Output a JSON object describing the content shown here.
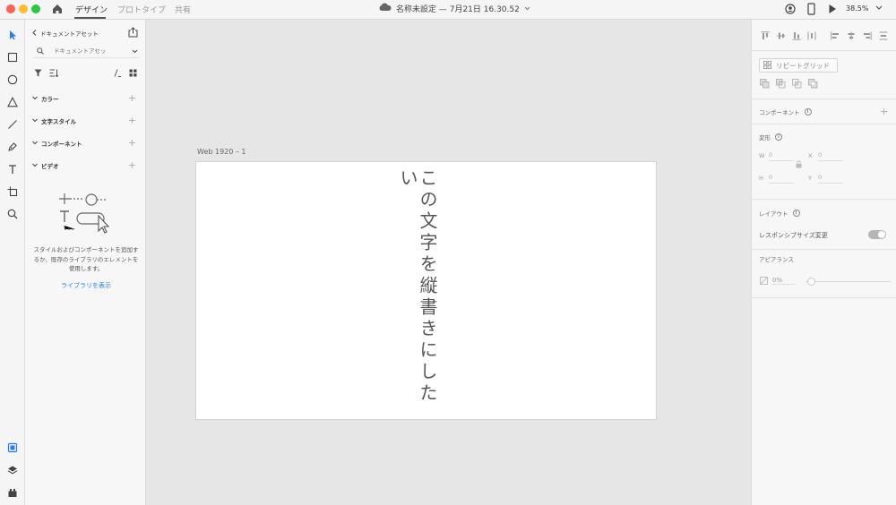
{
  "titlebar": {
    "tabs": [
      "デザイン",
      "プロトタイプ",
      "共有"
    ],
    "active_tab": "デザイン",
    "doc_title": "名称未設定 — 7月21日 16.30.52",
    "zoom": "38.5%"
  },
  "toolbar": {
    "tools": [
      "select-icon",
      "rectangle-icon",
      "ellipse-icon",
      "polygon-icon",
      "line-icon",
      "pen-icon",
      "text-icon",
      "artboard-icon",
      "zoom-icon"
    ],
    "bottom": [
      "assets-icon",
      "layers-icon",
      "plugins-icon"
    ]
  },
  "assets": {
    "back_label": "ドキュメントアセット",
    "search_placeholder": "ドキュメントアセッ",
    "sections": [
      "カラー",
      "文字スタイル",
      "コンポーネント",
      "ビデオ"
    ],
    "help_text": "スタイルおよびコンポーネントを追加するか、既存のライブラリのエレメントを使用します。",
    "library_link": "ライブラリを表示"
  },
  "canvas": {
    "artboard_label": "Web 1920 – 1",
    "vertical_text": "この文字を縦書きにしたい"
  },
  "props": {
    "repeat_grid": "リピートグリッド",
    "component_label": "コンポーネント",
    "transform_label": "変形",
    "w_key": "W",
    "w_val": "0",
    "x_key": "X",
    "x_val": "0",
    "h_key": "H",
    "h_val": "0",
    "y_key": "Y",
    "y_val": "0",
    "layout_label": "レイアウト",
    "responsive_label": "レスポンシブサイズ変更",
    "appearance_label": "アピアランス",
    "opacity": "0%"
  },
  "colors": {
    "accent": "#2680eb",
    "traffic_red": "#fe5f57",
    "traffic_yellow": "#febc2e",
    "traffic_green": "#28c840"
  }
}
